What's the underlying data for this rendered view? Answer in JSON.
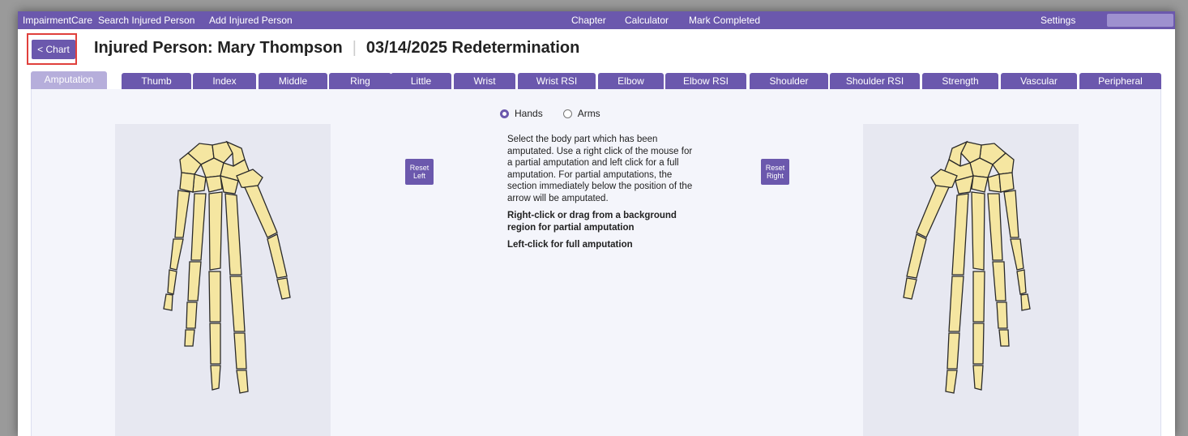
{
  "topbar": {
    "items": [
      "ImpairmentCare",
      "Search Injured Person",
      "Add Injured Person",
      "Chapter",
      "Calculator",
      "Mark Completed",
      "Settings"
    ]
  },
  "header": {
    "chart_button": "< Chart",
    "title": "Injured Person: Mary Thompson",
    "subtitle": "03/14/2025 Redetermination"
  },
  "tabs": [
    "Amputation",
    "Thumb",
    "Index",
    "Middle",
    "Ring",
    "Little",
    "Wrist",
    "Wrist RSI",
    "Elbow",
    "Elbow RSI",
    "Shoulder",
    "Shoulder RSI",
    "Strength",
    "Vascular",
    "Peripheral"
  ],
  "active_tab": "Amputation",
  "selector": {
    "options": [
      "Hands",
      "Arms"
    ],
    "selected": "Hands"
  },
  "buttons": {
    "reset_left": "Reset Left",
    "reset_right": "Reset Right"
  },
  "instructions": {
    "body": "Select the body part which has been amputated. Use a right click of the mouse for a partial amputation and left click for a full amputation. For partial amputations, the section immediately below the position of the arrow will be amputated.",
    "partial": "Right-click or drag from a background region for partial amputation",
    "full": "Left-click for full amputation"
  },
  "colors": {
    "accent": "#6b58ad",
    "tab_active": "#b6aedb",
    "bone_fill": "#f5e6a1",
    "bone_stroke": "#2a2a2a",
    "highlight": "#e0403c"
  }
}
